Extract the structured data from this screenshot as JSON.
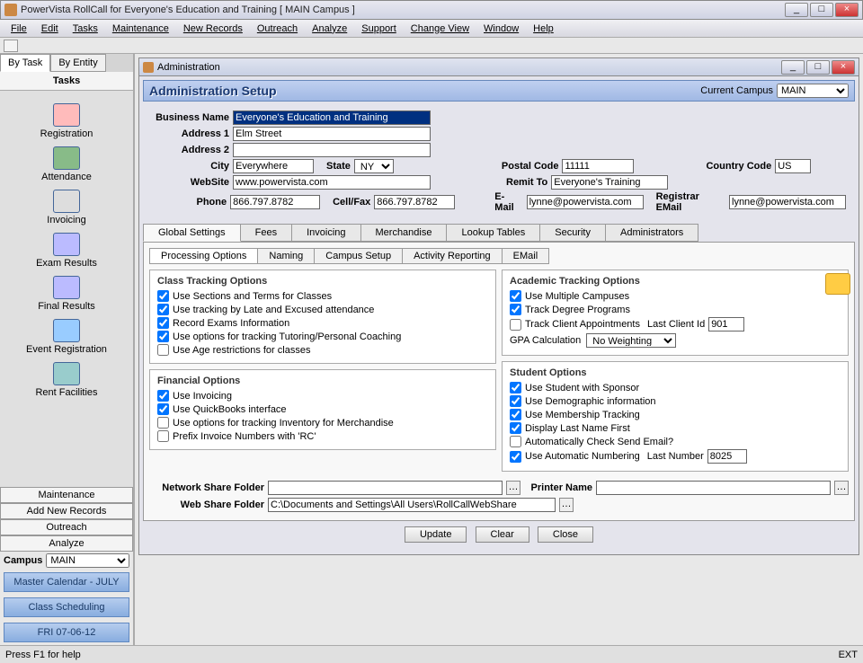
{
  "window": {
    "title": "PowerVista RollCall for Everyone's Education and Training    [ MAIN Campus ]",
    "min": "_",
    "max": "□",
    "close": "×"
  },
  "menu": [
    "File",
    "Edit",
    "Tasks",
    "Maintenance",
    "New Records",
    "Outreach",
    "Analyze",
    "Support",
    "Change View",
    "Window",
    "Help"
  ],
  "sidebar": {
    "tabs": [
      "By Task",
      "By Entity"
    ],
    "header": "Tasks",
    "tasks": [
      {
        "label": "Registration"
      },
      {
        "label": "Attendance"
      },
      {
        "label": "Invoicing"
      },
      {
        "label": "Exam Results"
      },
      {
        "label": "Final Results"
      },
      {
        "label": "Event Registration"
      },
      {
        "label": "Rent Facilities"
      }
    ],
    "btns": [
      "Maintenance",
      "Add New Records",
      "Outreach",
      "Analyze"
    ],
    "campus_label": "Campus",
    "campus_value": "MAIN",
    "big_btns": [
      "Master Calendar - JULY",
      "Class Scheduling",
      "FRI 07-06-12"
    ]
  },
  "mdi": {
    "title": "Administration"
  },
  "setup": {
    "title": "Administration Setup",
    "campus_label": "Current Campus",
    "campus_value": "MAIN",
    "fields": {
      "business_name_label": "Business Name",
      "business_name": "Everyone's Education and Training",
      "address1_label": "Address 1",
      "address1": "Elm Street",
      "address2_label": "Address 2",
      "address2": "",
      "city_label": "City",
      "city": "Everywhere",
      "state_label": "State",
      "state": "NY",
      "website_label": "WebSite",
      "website": "www.powervista.com",
      "phone_label": "Phone",
      "phone": "866.797.8782",
      "cellfax_label": "Cell/Fax",
      "cellfax": "866.797.8782",
      "postal_label": "Postal Code",
      "postal": "11111",
      "remit_label": "Remit To",
      "remit": "Everyone's Training",
      "email_label": "E-Mail",
      "email": "lynne@powervista.com",
      "country_label": "Country Code",
      "country": "US",
      "registrar_label": "Registrar EMail",
      "registrar": "lynne@powervista.com"
    },
    "tabs1": [
      "Global Settings",
      "Fees",
      "Invoicing",
      "Merchandise",
      "Lookup Tables",
      "Security",
      "Administrators"
    ],
    "tabs2": [
      "Processing Options",
      "Naming",
      "Campus Setup",
      "Activity Reporting",
      "EMail"
    ],
    "groups": {
      "class_tracking": {
        "title": "Class Tracking Options",
        "opts": [
          {
            "label": "Use Sections and Terms for Classes",
            "checked": true
          },
          {
            "label": "Use tracking by Late and Excused attendance",
            "checked": true
          },
          {
            "label": "Record Exams Information",
            "checked": true
          },
          {
            "label": "Use options for tracking Tutoring/Personal Coaching",
            "checked": true
          },
          {
            "label": "Use Age restrictions for classes",
            "checked": false
          }
        ]
      },
      "financial": {
        "title": "Financial Options",
        "opts": [
          {
            "label": "Use Invoicing",
            "checked": true
          },
          {
            "label": "Use QuickBooks interface",
            "checked": true
          },
          {
            "label": "Use options for tracking Inventory for Merchandise",
            "checked": false
          },
          {
            "label": "Prefix Invoice Numbers with 'RC'",
            "checked": false
          }
        ]
      },
      "academic": {
        "title": "Academic Tracking Options",
        "opts": [
          {
            "label": "Use Multiple Campuses",
            "checked": true
          },
          {
            "label": "Track Degree Programs",
            "checked": true
          },
          {
            "label": "Track Client Appointments",
            "checked": false
          }
        ],
        "last_client_label": "Last Client Id",
        "last_client": "901",
        "gpa_label": "GPA Calculation",
        "gpa_value": "No Weighting"
      },
      "student": {
        "title": "Student Options",
        "opts": [
          {
            "label": "Use Student with Sponsor",
            "checked": true
          },
          {
            "label": "Use Demographic information",
            "checked": true
          },
          {
            "label": "Use Membership Tracking",
            "checked": true
          },
          {
            "label": "Display Last Name First",
            "checked": true
          },
          {
            "label": "Automatically Check Send Email?",
            "checked": false
          },
          {
            "label": "Use Automatic Numbering",
            "checked": true
          }
        ],
        "last_number_label": "Last Number",
        "last_number": "8025"
      }
    },
    "net_share_label": "Network Share Folder",
    "net_share": "",
    "printer_label": "Printer Name",
    "printer": "",
    "web_share_label": "Web Share Folder",
    "web_share": "C:\\Documents and Settings\\All Users\\RollCallWebShare",
    "buttons": [
      "Update",
      "Clear",
      "Close"
    ]
  },
  "status": {
    "left": "Press F1 for help",
    "right": "EXT"
  }
}
